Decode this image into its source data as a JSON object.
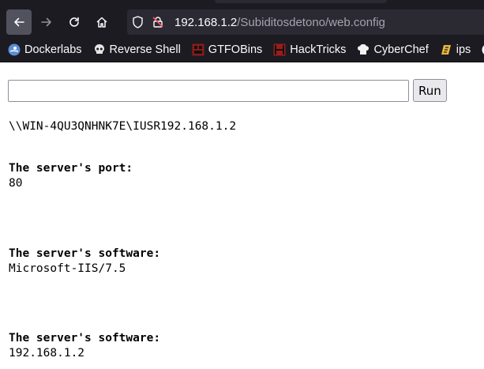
{
  "browser": {
    "url_host": "192.168.1.2",
    "url_path": "/Subiditosdetono/web.config"
  },
  "bookmarks": [
    {
      "label": "Dockerlabs",
      "icon": "dockerlabs-icon"
    },
    {
      "label": "Reverse Shell",
      "icon": "skull-icon"
    },
    {
      "label": "GTFOBins",
      "icon": "gtfobins-icon"
    },
    {
      "label": "HackTricks",
      "icon": "hacktricks-icon"
    },
    {
      "label": "CyberChef",
      "icon": "cyberchef-icon"
    },
    {
      "label": "ips",
      "icon": "ips-icon"
    }
  ],
  "form": {
    "command_value": "",
    "run_label": "Run"
  },
  "output": {
    "user": "\\\\WIN-4QU3QNHNK7E\\IUSR192.168.1.2",
    "port_heading": "The server's port:",
    "port_value": "80",
    "software_heading_1": "The server's software:",
    "software_value_1": "Microsoft-IIS/7.5",
    "software_heading_2": "The server's software:",
    "software_value_2": "192.168.1.2"
  }
}
